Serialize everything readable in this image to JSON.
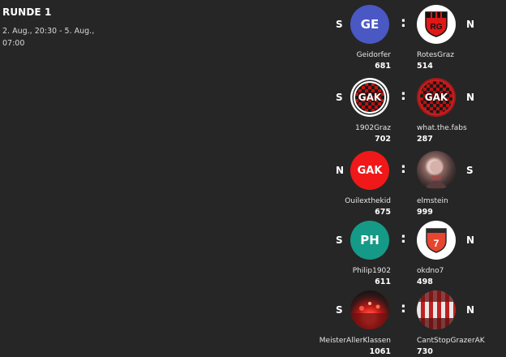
{
  "round": {
    "title": "RUNDE 1",
    "dates": "2. Aug., 20:30 - 5. Aug., 07:00"
  },
  "colors": {
    "background": "#262626",
    "blue": "#4a58c4",
    "red": "#f01818",
    "teal": "#159a87",
    "darkred": "#a81818"
  },
  "matches": [
    {
      "left": {
        "name": "Geidorfer",
        "score": "681",
        "result": "S",
        "avatar_text": "GE",
        "avatar_kind": "initials-blue"
      },
      "right": {
        "name": "RotesGraz",
        "score": "514",
        "result": "N",
        "avatar_text": "RG",
        "avatar_kind": "rg-crest"
      }
    },
    {
      "left": {
        "name": "1902Graz",
        "score": "702",
        "result": "S",
        "avatar_text": "GAK",
        "avatar_kind": "gak-checker-white"
      },
      "right": {
        "name": "what.the.fabs",
        "score": "287",
        "result": "N",
        "avatar_text": "GAK",
        "avatar_kind": "gak-checker-red"
      }
    },
    {
      "left": {
        "name": "Ouilexthekid",
        "score": "675",
        "result": "N",
        "avatar_text": "GAK",
        "avatar_kind": "gak-red-circle"
      },
      "right": {
        "name": "elmstein",
        "score": "999",
        "result": "S",
        "avatar_text": "",
        "avatar_kind": "photo-portrait"
      }
    },
    {
      "left": {
        "name": "Philip1902",
        "score": "611",
        "result": "S",
        "avatar_text": "PH",
        "avatar_kind": "initials-teal"
      },
      "right": {
        "name": "okdno7",
        "score": "498",
        "result": "N",
        "avatar_text": "7",
        "avatar_kind": "number-shield"
      }
    },
    {
      "left": {
        "name": "MeisterAllerKlassen",
        "score": "1061",
        "result": "S",
        "avatar_text": "",
        "avatar_kind": "photo-stadium"
      },
      "right": {
        "name": "CantStopGrazerAK",
        "score": "730",
        "result": "N",
        "avatar_text": "",
        "avatar_kind": "photo-banner"
      }
    }
  ]
}
